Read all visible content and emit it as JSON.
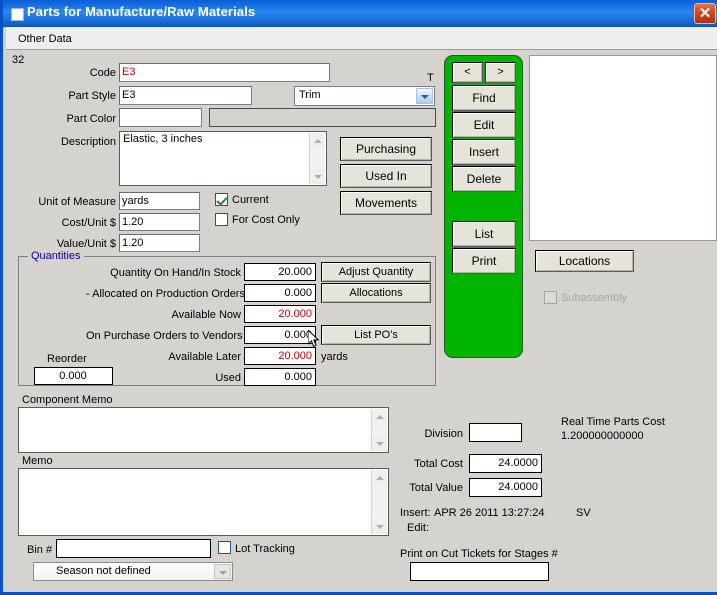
{
  "window": {
    "title": "Parts for Manufacture/Raw Materials",
    "close_label": "✕",
    "icon_name": "window-icon"
  },
  "tabs": [
    {
      "label": "Other Data"
    }
  ],
  "record": {
    "record_number": "32",
    "type_flag": "T"
  },
  "form": {
    "code": {
      "label": "Code",
      "value": "E3"
    },
    "part_style": {
      "label": "Part Style",
      "value": "E3"
    },
    "part_type": {
      "label": "",
      "value": "Trim"
    },
    "part_color": {
      "label": "Part Color",
      "value": "",
      "extra_value": ""
    },
    "description": {
      "label": "Description",
      "value": "Elastic, 3 inches"
    },
    "unit_of_measure": {
      "label": "Unit of Measure",
      "value": "yards"
    },
    "cost_per_unit": {
      "label": "Cost/Unit $",
      "value": "1.20"
    },
    "value_per_unit": {
      "label": "Value/Unit $",
      "value": "1.20"
    },
    "current": {
      "label": "Current",
      "checked": true
    },
    "for_cost_only": {
      "label": "For Cost Only",
      "checked": false
    }
  },
  "action_buttons": {
    "purchasing": "Purchasing",
    "used_in": "Used In",
    "movements": "Movements"
  },
  "nav_panel": {
    "prev": "<",
    "next": ">",
    "find": "Find",
    "edit": "Edit",
    "insert": "Insert",
    "delete": "Delete",
    "list": "List",
    "print": "Print"
  },
  "right_panel": {
    "locations": "Locations",
    "subassembly": {
      "label": "Subassembly",
      "checked": false,
      "enabled": false
    }
  },
  "quantities": {
    "title": "Quantities",
    "rows": [
      {
        "label": "Quantity On Hand/In Stock",
        "value": "20.000",
        "red": false,
        "button": "Adjust Quantity"
      },
      {
        "label": "- Allocated on Production Orders",
        "value": "0.000",
        "red": false,
        "button": "Allocations"
      },
      {
        "label": "Available Now",
        "value": "20.000",
        "red": true,
        "button": ""
      },
      {
        "label": "On Purchase Orders to Vendors",
        "value": "0.000",
        "red": false,
        "button": "List PO's"
      },
      {
        "label": "Available Later",
        "value": "20.000",
        "red": true,
        "button": "",
        "suffix": "yards"
      },
      {
        "label": "Used",
        "value": "0.000",
        "red": false,
        "button": ""
      }
    ],
    "reorder": {
      "label": "Reorder",
      "value": "0.000"
    }
  },
  "memos": {
    "component_memo": {
      "label": "Component Memo",
      "value": ""
    },
    "memo": {
      "label": "Memo",
      "value": ""
    }
  },
  "bottom": {
    "bin": {
      "label": "Bin #",
      "value": ""
    },
    "lot_tracking": {
      "label": "Lot Tracking",
      "checked": false
    },
    "season": {
      "value": "Season not defined"
    }
  },
  "info": {
    "division": {
      "label": "Division",
      "value": ""
    },
    "total_cost": {
      "label": "Total Cost",
      "value": "24.0000"
    },
    "total_value": {
      "label": "Total Value",
      "value": "24.0000"
    },
    "real_time_parts_cost_label": "Real Time Parts Cost",
    "real_time_parts_cost_value": "1.200000000000",
    "insert_label": "Insert:",
    "insert_value": "APR 26 2011  13:27:24",
    "insert_user": "SV",
    "edit_label": "Edit:",
    "edit_value": "",
    "cut_tickets_label": "Print on Cut Tickets for Stages #",
    "cut_tickets_value": ""
  },
  "colors": {
    "titlebar": "#1269e0",
    "green_panel": "#00b400",
    "face": "#d6d3ce",
    "button_face": "#e6e3da",
    "red_value": "#c00000",
    "group_title": "#0000b0"
  }
}
